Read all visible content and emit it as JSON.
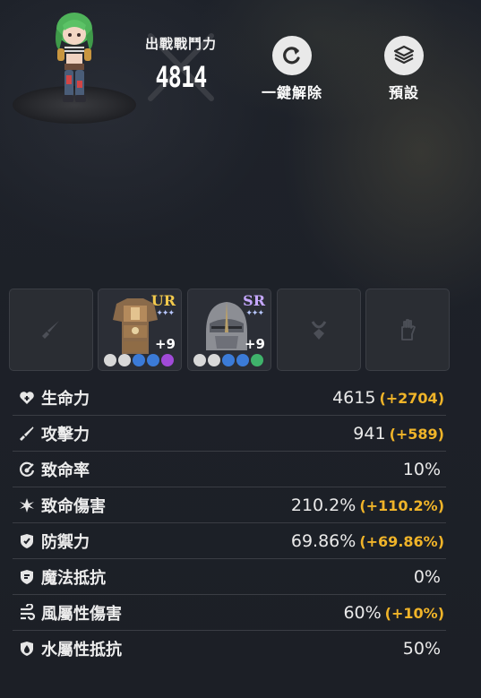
{
  "header": {
    "power_label": "出戰戰鬥力",
    "power_value": "4814",
    "reset_button_label": "一鍵解除",
    "reset_icon": "refresh-icon",
    "preset_button_label": "預設",
    "preset_icon": "layers-icon"
  },
  "equipment": {
    "slots": [
      {
        "slot": "weapon",
        "empty": true,
        "icon": "sword-icon"
      },
      {
        "slot": "armor",
        "empty": false,
        "grade": "UR",
        "enhance": "+9",
        "icon": "armor-icon"
      },
      {
        "slot": "helmet",
        "empty": false,
        "grade": "SR",
        "enhance": "+9",
        "icon": "helmet-icon"
      },
      {
        "slot": "accessory",
        "empty": true,
        "icon": "necklace-icon"
      },
      {
        "slot": "gloves",
        "empty": true,
        "icon": "glove-icon"
      }
    ]
  },
  "stats": [
    {
      "label": "生命力",
      "value": "4615",
      "bonus": "(+2704)",
      "icon": "heart-plus-icon"
    },
    {
      "label": "攻擊力",
      "value": "941",
      "bonus": "(+589)",
      "icon": "sword-icon"
    },
    {
      "label": "致命率",
      "value": "10%",
      "bonus": "",
      "icon": "crit-rate-icon"
    },
    {
      "label": "致命傷害",
      "value": "210.2%",
      "bonus": "(+110.2%)",
      "icon": "crit-damage-icon"
    },
    {
      "label": "防禦力",
      "value": "69.86%",
      "bonus": "(+69.86%)",
      "icon": "shield-icon"
    },
    {
      "label": "魔法抵抗",
      "value": "0%",
      "bonus": "",
      "icon": "magic-shield-icon"
    },
    {
      "label": "風屬性傷害",
      "value": "60%",
      "bonus": "(+10%)",
      "icon": "wind-icon"
    },
    {
      "label": "水屬性抵抗",
      "value": "50%",
      "bonus": "",
      "icon": "water-shield-icon"
    }
  ],
  "colors": {
    "bonus": "#f0b429",
    "background": "#1d2027",
    "divider": "#3a3d44",
    "ur_grade": "#f2c94c",
    "sr_grade": "#c6a8ff"
  }
}
